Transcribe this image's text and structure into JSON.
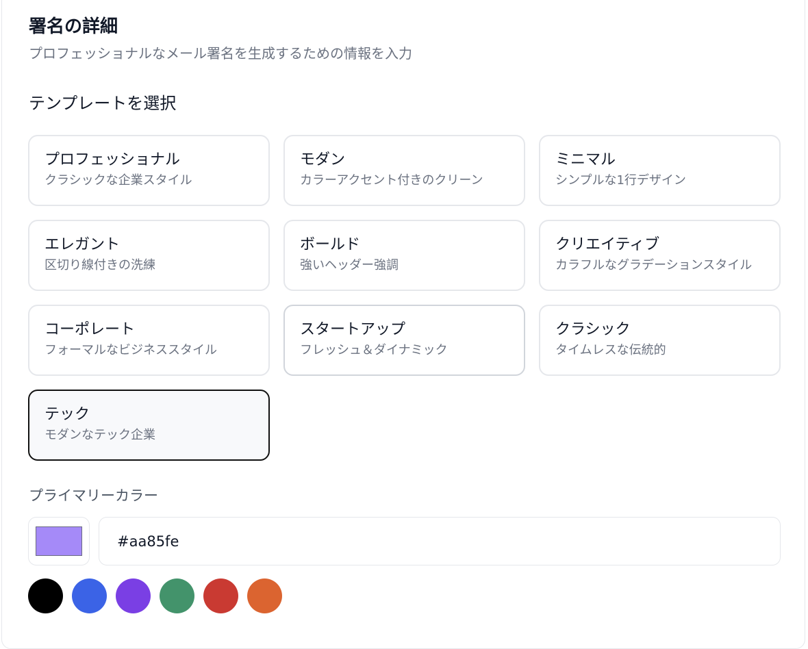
{
  "header": {
    "title": "署名の詳細",
    "subtitle": "プロフェッショナルなメール署名を生成するための情報を入力"
  },
  "templates": {
    "label": "テンプレートを選択",
    "selected": "テック",
    "items": [
      {
        "name": "プロフェッショナル",
        "desc": "クラシックな企業スタイル"
      },
      {
        "name": "モダン",
        "desc": "カラーアクセント付きのクリーン"
      },
      {
        "name": "ミニマル",
        "desc": "シンプルな1行デザイン"
      },
      {
        "name": "エレガント",
        "desc": "区切り線付きの洗練"
      },
      {
        "name": "ボールド",
        "desc": "強いヘッダー強調"
      },
      {
        "name": "クリエイティブ",
        "desc": "カラフルなグラデーションスタイル"
      },
      {
        "name": "コーポレート",
        "desc": "フォーマルなビジネススタイル"
      },
      {
        "name": "スタートアップ",
        "desc": "フレッシュ＆ダイナミック"
      },
      {
        "name": "クラシック",
        "desc": "タイムレスな伝統的"
      },
      {
        "name": "テック",
        "desc": "モダンなテック企業"
      }
    ]
  },
  "color": {
    "label": "プライマリーカラー",
    "value": "#aa85fe",
    "swatch_display": "#a58af8",
    "presets": [
      "#000000",
      "#3b63e6",
      "#7a3fe4",
      "#43936b",
      "#c93a32",
      "#db6430"
    ]
  }
}
